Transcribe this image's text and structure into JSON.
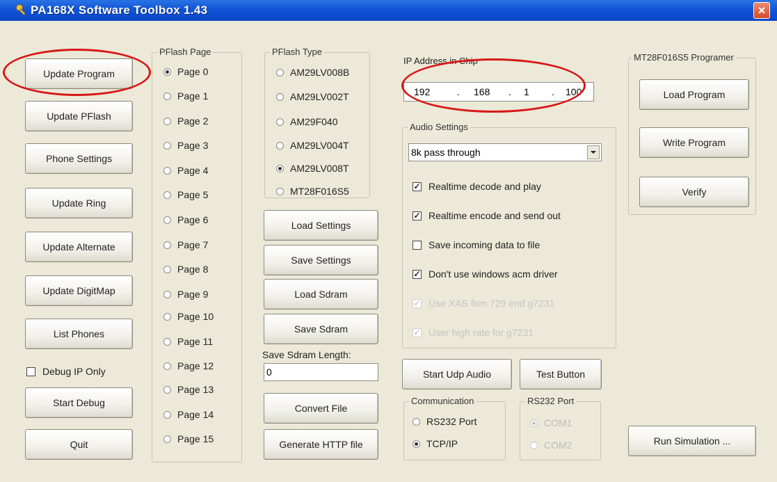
{
  "window": {
    "title": "PA168X Software Toolbox 1.43",
    "close": "×"
  },
  "left_buttons": {
    "update_program": "Update Program",
    "update_pflash": "Update PFlash",
    "phone_settings": "Phone Settings",
    "update_ring": "Update Ring",
    "update_alternate": "Update Alternate",
    "update_digitmap": "Update DigitMap",
    "list_phones": "List Phones",
    "debug_ip_only": "Debug IP Only",
    "start_debug": "Start Debug",
    "quit": "Quit"
  },
  "pflash_page": {
    "title": "PFlash Page",
    "pages": [
      "Page 0",
      "Page 1",
      "Page 2",
      "Page 3",
      "Page 4",
      "Page 5",
      "Page 6",
      "Page 7",
      "Page 8",
      "Page 9",
      "Page 10",
      "Page 11",
      "Page 12",
      "Page 13",
      "Page 14",
      "Page 15"
    ],
    "selected": "Page 0"
  },
  "pflash_type": {
    "title": "PFlash Type",
    "types": [
      "AM29LV008B",
      "AM29LV002T",
      "AM29F040",
      "AM29LV004T",
      "AM29LV008T",
      "MT28F016S5"
    ],
    "selected": "AM29LV008T"
  },
  "middle_buttons": {
    "load_settings": "Load Settings",
    "save_settings": "Save Settings",
    "load_sdram": "Load Sdram",
    "save_sdram": "Save Sdram",
    "convert_file": "Convert File",
    "generate_http": "Generate HTTP file"
  },
  "sdram": {
    "label": "Save Sdram Length:",
    "value": "0"
  },
  "ip": {
    "label": "IP Address in Chip",
    "octets": [
      "192",
      "168",
      "1",
      "100"
    ],
    "dot": "."
  },
  "audio": {
    "title": "Audio Settings",
    "mode": "8k pass through",
    "options": [
      {
        "label": "Realtime decode and play",
        "checked": true,
        "enabled": true
      },
      {
        "label": "Realtime encode and send out",
        "checked": true,
        "enabled": true
      },
      {
        "label": "Save incoming data to file",
        "checked": false,
        "enabled": true
      },
      {
        "label": "Don't use windows acm driver",
        "checked": true,
        "enabled": true
      },
      {
        "label": "Use XAS firm 729 end g7231",
        "checked": true,
        "enabled": false
      },
      {
        "label": "User high rate for g7231",
        "checked": true,
        "enabled": false
      }
    ]
  },
  "audio_buttons": {
    "start_udp": "Start Udp Audio",
    "test": "Test Button"
  },
  "communication": {
    "title": "Communication",
    "options": [
      "RS232 Port",
      "TCP/IP"
    ],
    "selected": "TCP/IP"
  },
  "rs232": {
    "title": "RS232 Port",
    "options": [
      "COM1",
      "COM2"
    ],
    "selected": "COM1"
  },
  "programmer": {
    "title": "MT28F016S5 Programer",
    "load": "Load Program",
    "write": "Write Program",
    "verify": "Verify"
  },
  "run_simulation": "Run Simulation ...",
  "check_mark": "✓",
  "colors": {
    "titlebar": "#1155d6",
    "window_bg": "#ece9d8",
    "highlight": "#d81818"
  },
  "icons": {
    "title": "key-icon",
    "close": "close-icon",
    "dropdown": "chevron-down-icon"
  }
}
